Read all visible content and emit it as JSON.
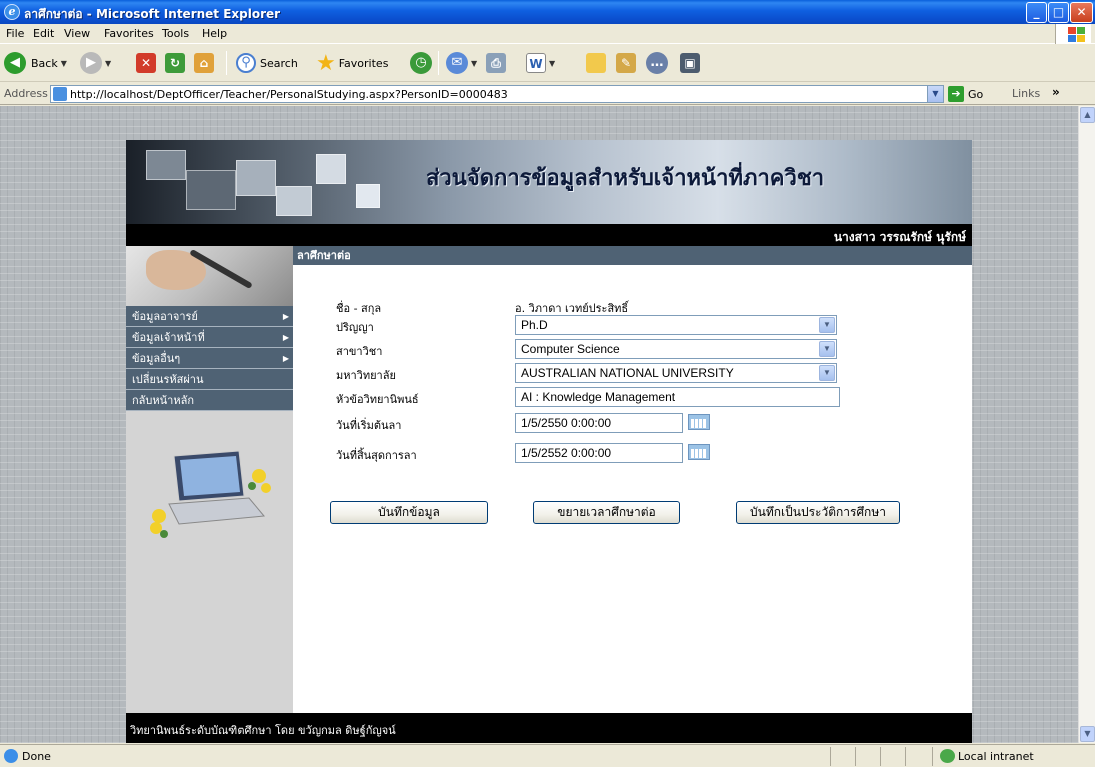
{
  "window": {
    "title": "ลาศึกษาต่อ - Microsoft Internet Explorer",
    "controls": [
      "minimize",
      "maximize",
      "close"
    ]
  },
  "menubar": {
    "items": [
      "File",
      "Edit",
      "View",
      "Favorites",
      "Tools",
      "Help"
    ]
  },
  "toolbar": {
    "back_label": "Back",
    "search_label": "Search",
    "favorites_label": "Favorites"
  },
  "address": {
    "label": "Address",
    "url": "http://localhost/DeptOfficer/Teacher/PersonalStudying.aspx?PersonID=0000483",
    "go_label": "Go",
    "links_label": "Links"
  },
  "page": {
    "banner_title": "ส่วนจัดการข้อมูลสำหรับเจ้าหน้าที่ภาควิชา",
    "user_name": "นางสาว วรรณรักษ์ นุรักษ์",
    "section_title": "ลาศึกษาต่อ",
    "sidebar": {
      "items": [
        {
          "label": "ข้อมูลอาจารย์",
          "has_submenu": true
        },
        {
          "label": "ข้อมูลเจ้าหน้าที่",
          "has_submenu": true
        },
        {
          "label": "ข้อมูลอื่นๆ",
          "has_submenu": true
        },
        {
          "label": "เปลี่ยนรหัสผ่าน",
          "has_submenu": false
        },
        {
          "label": "กลับหน้าหลัก",
          "has_submenu": false
        }
      ]
    },
    "form": {
      "name_label": "ชื่อ - สกุล",
      "name_value": "อ. วิภาดา เวทย์ประสิทธิ์",
      "degree_label": "ปริญญา",
      "degree_value": "Ph.D",
      "major_label": "สาขาวิชา",
      "major_value": "Computer Science",
      "university_label": "มหาวิทยาลัย",
      "university_value": "AUSTRALIAN NATIONAL UNIVERSITY",
      "thesis_label": "หัวข้อวิทยานิพนธ์",
      "thesis_value": "AI : Knowledge Management",
      "start_label": "วันที่เริ่มต้นลา",
      "start_value": "1/5/2550 0:00:00",
      "end_label": "วันที่สิ้นสุดการลา",
      "end_value": "1/5/2552 0:00:00"
    },
    "buttons": {
      "save": "บันทึกข้อมูล",
      "extend": "ขยายเวลาศึกษาต่อ",
      "history": "บันทึกเป็นประวัติการศึกษา"
    },
    "footer": "วิทยานิพนธ์ระดับบัณฑิตศึกษา โดย ขวัญกมล ดิษฐ์กัญจน์"
  },
  "statusbar": {
    "status": "Done",
    "zone": "Local intranet"
  },
  "colors": {
    "titlebar": "#0A4FCF",
    "menu_bg": "#4F6274",
    "page_bg": "#B4B9BD"
  }
}
